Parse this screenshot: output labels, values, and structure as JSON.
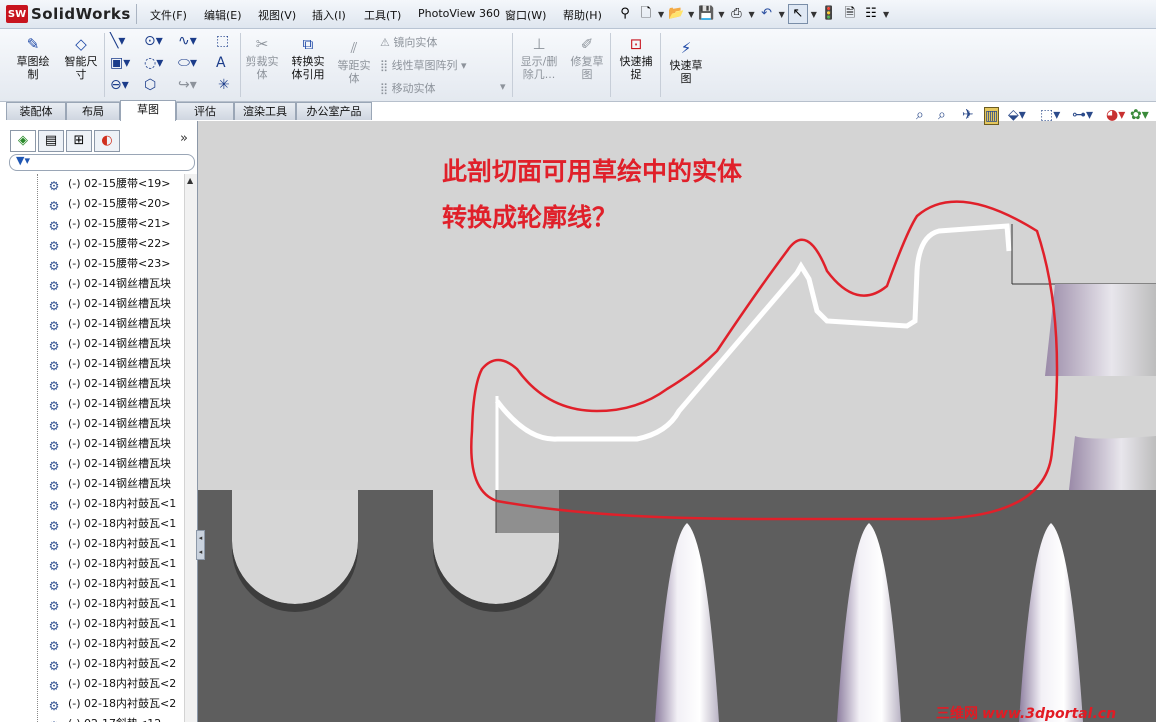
{
  "app": {
    "name": "SolidWorks",
    "badge": "SW"
  },
  "menu": [
    "文件(F)",
    "编辑(E)",
    "视图(V)",
    "插入(I)",
    "工具(T)",
    "PhotoView 360",
    "窗口(W)",
    "帮助(H)"
  ],
  "ribbon": {
    "sketch": "草图绘\n制",
    "smart_dim": "智能尺\n寸",
    "trim": "剪裁实\n体",
    "convert": "转换实\n体引用",
    "offset": "等距实\n体",
    "mirror": "镜向实体",
    "linear_pattern": "线性草图阵列",
    "move": "移动实体",
    "show_delete": "显示/删\n除几...",
    "repair": "修复草\n图",
    "quick_snap": "快速捕\n捉",
    "rapid_sketch": "快速草\n图"
  },
  "tabs": [
    "装配体",
    "布局",
    "草图",
    "评估",
    "渲染工具",
    "办公室产品"
  ],
  "active_tab": "草图",
  "tree": [
    "(-) 02-15腰带<19>",
    "(-) 02-15腰带<20>",
    "(-) 02-15腰带<21>",
    "(-) 02-15腰带<22>",
    "(-) 02-15腰带<23>",
    "(-) 02-14钢丝槽瓦块",
    "(-) 02-14钢丝槽瓦块",
    "(-) 02-14钢丝槽瓦块",
    "(-) 02-14钢丝槽瓦块",
    "(-) 02-14钢丝槽瓦块",
    "(-) 02-14钢丝槽瓦块",
    "(-) 02-14钢丝槽瓦块",
    "(-) 02-14钢丝槽瓦块",
    "(-) 02-14钢丝槽瓦块",
    "(-) 02-14钢丝槽瓦块",
    "(-) 02-14钢丝槽瓦块",
    "(-) 02-18内衬鼓瓦<1",
    "(-) 02-18内衬鼓瓦<1",
    "(-) 02-18内衬鼓瓦<1",
    "(-) 02-18内衬鼓瓦<1",
    "(-) 02-18内衬鼓瓦<1",
    "(-) 02-18内衬鼓瓦<1",
    "(-) 02-18内衬鼓瓦<1",
    "(-) 02-18内衬鼓瓦<2",
    "(-) 02-18内衬鼓瓦<2",
    "(-) 02-18内衬鼓瓦<2",
    "(-) 02-18内衬鼓瓦<2",
    "(-) 02-17斜垫<12"
  ],
  "annotation": {
    "line1": "此剖切面可用草绘中的实体",
    "line2": "转换成轮廓线？"
  },
  "watermark": {
    "site": "三维网",
    "url": "www.3dportal.cn"
  },
  "colors": {
    "annotation": "#e0202a",
    "viewport_bg": "#d6d6d6",
    "section_dark": "#5e5e5e"
  },
  "icons": {
    "feature_manager_tab": "feature-tree-icon",
    "property_tab": "property-icon",
    "config_tab": "configuration-icon",
    "display_tab": "appearance-icon",
    "filter": "filter-icon",
    "part_item": "part-icon"
  }
}
